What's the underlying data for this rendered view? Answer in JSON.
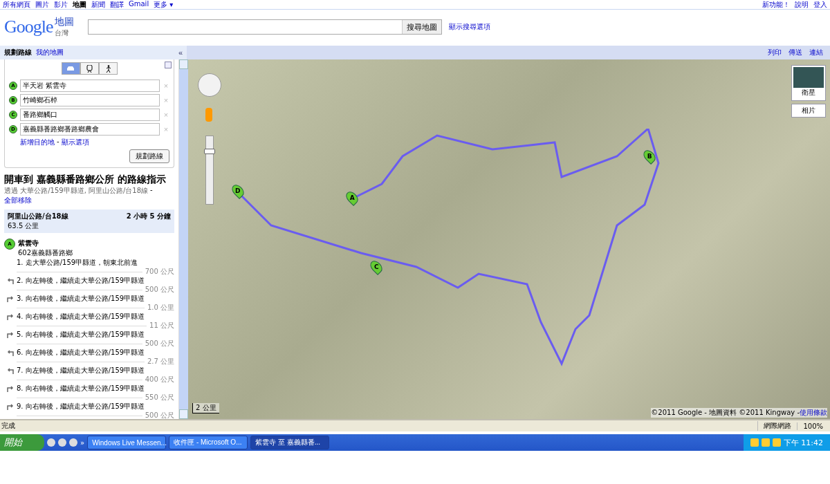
{
  "top_nav": {
    "links": [
      {
        "label": "所有網頁",
        "selected": false
      },
      {
        "label": "圖片",
        "selected": false
      },
      {
        "label": "影片",
        "selected": false
      },
      {
        "label": "地圖",
        "selected": true
      },
      {
        "label": "新聞",
        "selected": false
      },
      {
        "label": "翻譯",
        "selected": false
      },
      {
        "label": "Gmail",
        "selected": false
      },
      {
        "label": "更多 ▾",
        "selected": false
      }
    ],
    "user_links": [
      "新功能！",
      "說明",
      "登入"
    ]
  },
  "header": {
    "logo": "Google",
    "product": "地圖",
    "region": "台灣",
    "search_button": "搜尋地圖",
    "options_link": "顯示搜尋選項"
  },
  "panel_tabs": [
    {
      "label": "規劃路線",
      "selected": true
    },
    {
      "label": "我的地圖",
      "selected": false
    }
  ],
  "collapse": "«",
  "map_actions": [
    "列印",
    "傳送",
    "連結"
  ],
  "route_form": {
    "modes": [
      {
        "kind": "car",
        "selected": true
      },
      {
        "kind": "transit",
        "selected": false
      },
      {
        "kind": "walk",
        "selected": false
      }
    ],
    "stops": [
      {
        "letter": "A",
        "value": "半天岩 紫雲寺"
      },
      {
        "letter": "B",
        "value": "竹崎鄉石棹"
      },
      {
        "letter": "C",
        "value": "番路鄉觸口"
      },
      {
        "letter": "D",
        "value": "嘉義縣番路鄉番路鄉農會"
      }
    ],
    "remove": "×",
    "add_link": "新增目的地",
    "separator": "-",
    "options_link": "顯示選項",
    "submit": "規劃路線"
  },
  "directions": {
    "title": "開車到 嘉義縣番路鄉公所 的路線指示",
    "via": "透過 大華公路/159甲縣道, 阿里山公路/台18線",
    "separator": "-",
    "remove_all": "全部移除",
    "summary": {
      "route": "阿里山公路/台18線",
      "time": "2 小時 5 分鐘",
      "distance": "63.5 公里"
    },
    "start": {
      "letter": "A",
      "name": "紫雲寺",
      "address": "602嘉義縣番路鄉"
    },
    "steps": [
      {
        "kind": "straight",
        "text": "1. 走大華公路/159甲縣道，朝東北前進",
        "distance": "700 公尺"
      },
      {
        "kind": "left",
        "text": "2. 向左轉後，繼續走大華公路/159甲縣道",
        "distance": "500 公尺"
      },
      {
        "kind": "right",
        "text": "3. 向右轉後，繼續走大華公路/159甲縣道",
        "distance": "1.0 公里"
      },
      {
        "kind": "right",
        "text": "4. 向右轉後，繼續走大華公路/159甲縣道",
        "distance": "11 公尺"
      },
      {
        "kind": "right",
        "text": "5. 向右轉後，繼續走大華公路/159甲縣道",
        "distance": "500 公尺"
      },
      {
        "kind": "left",
        "text": "6. 向左轉後，繼續走大華公路/159甲縣道",
        "distance": "2.7 公里"
      },
      {
        "kind": "left",
        "text": "7. 向左轉後，繼續走大華公路/159甲縣道",
        "distance": "400 公尺"
      },
      {
        "kind": "right",
        "text": "8. 向右轉後，繼續走大華公路/159甲縣道",
        "distance": "550 公尺"
      },
      {
        "kind": "right",
        "text": "9. 向右轉後，繼續走大華公路/159甲縣道",
        "distance": "500 公尺"
      }
    ]
  },
  "map": {
    "zoom": {
      "level": 0.8
    },
    "markers": [
      {
        "letter": "A"
      },
      {
        "letter": "B"
      },
      {
        "letter": "C"
      },
      {
        "letter": "D"
      }
    ],
    "satellite": "衛星",
    "photos": "相片",
    "scale": "2 公里",
    "copyright": "©2011 Google - 地圖資料 ©2011 Kingway - ",
    "terms": "使用條款"
  },
  "status_bar": {
    "text": "完成",
    "zone": "網際網路",
    "zoom": "100%"
  },
  "taskbar": {
    "start": "開始",
    "more": "»",
    "tasks": [
      {
        "label": "Windows Live Messen...",
        "selected": false
      },
      {
        "label": "收件匣 - Microsoft O...",
        "selected": false
      },
      {
        "label": "紫雲寺 至 嘉義縣番...",
        "selected": true
      }
    ],
    "clock": "下午 11:42"
  }
}
